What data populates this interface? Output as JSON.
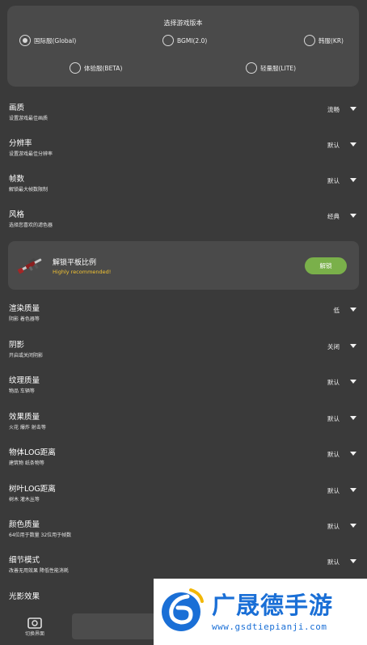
{
  "version_selector": {
    "title": "选择游戏版本",
    "options": [
      {
        "label": "国际服(Global)",
        "selected": true
      },
      {
        "label": "BGMI(2.0)",
        "selected": false
      },
      {
        "label": "韩服(KR)",
        "selected": false
      },
      {
        "label": "体验服(BETA)",
        "selected": false
      },
      {
        "label": "轻量服(LITE)",
        "selected": false
      }
    ]
  },
  "settings_top": [
    {
      "title": "画质",
      "subtitle": "设置游戏最佳画质",
      "value": "流畅"
    },
    {
      "title": "分辨率",
      "subtitle": "设置游戏最佳分辨率",
      "value": "默认"
    },
    {
      "title": "帧数",
      "subtitle": "解锁最大帧数限制",
      "value": "默认"
    },
    {
      "title": "风格",
      "subtitle": "选择您喜欢的滤色器",
      "value": "经典"
    }
  ],
  "unlock_card": {
    "title": "解锁平板比例",
    "subtitle": "Highly recommended!",
    "button_label": "解锁",
    "icon": "rifle-icon"
  },
  "settings_bottom": [
    {
      "title": "渲染质量",
      "subtitle": "阴影 着色器等",
      "value": "低"
    },
    {
      "title": "阴影",
      "subtitle": "开启或关闭阴影",
      "value": "关闭"
    },
    {
      "title": "纹理质量",
      "subtitle": "物品 车辆等",
      "value": "默认"
    },
    {
      "title": "效果质量",
      "subtitle": "火花 爆炸 射击等",
      "value": "默认"
    },
    {
      "title": "物体LOG距离",
      "subtitle": "建筑物 纸条物等",
      "value": "默认"
    },
    {
      "title": "树叶LOG距离",
      "subtitle": "树木 灌木丛等",
      "value": "默认"
    },
    {
      "title": "颜色质量",
      "subtitle": "64位用于数量 32位用于帧数",
      "value": "默认"
    },
    {
      "title": "细节模式",
      "subtitle": "改善无用效果 降低性能消耗",
      "value": "默认"
    },
    {
      "title": "光影效果",
      "subtitle": "",
      "value": ""
    }
  ],
  "bottom_bar": {
    "label": "切换界面",
    "icon": "switch-screen-icon"
  },
  "watermark": {
    "title": "广晟德手游",
    "url": "www.gsdtiepianji.com"
  },
  "colors": {
    "background": "#3a3a3a",
    "card": "#4a4a4a",
    "accent_green": "#7ab04a",
    "highlight_yellow": "#f1c232",
    "watermark_blue": "#1a6fd6"
  }
}
